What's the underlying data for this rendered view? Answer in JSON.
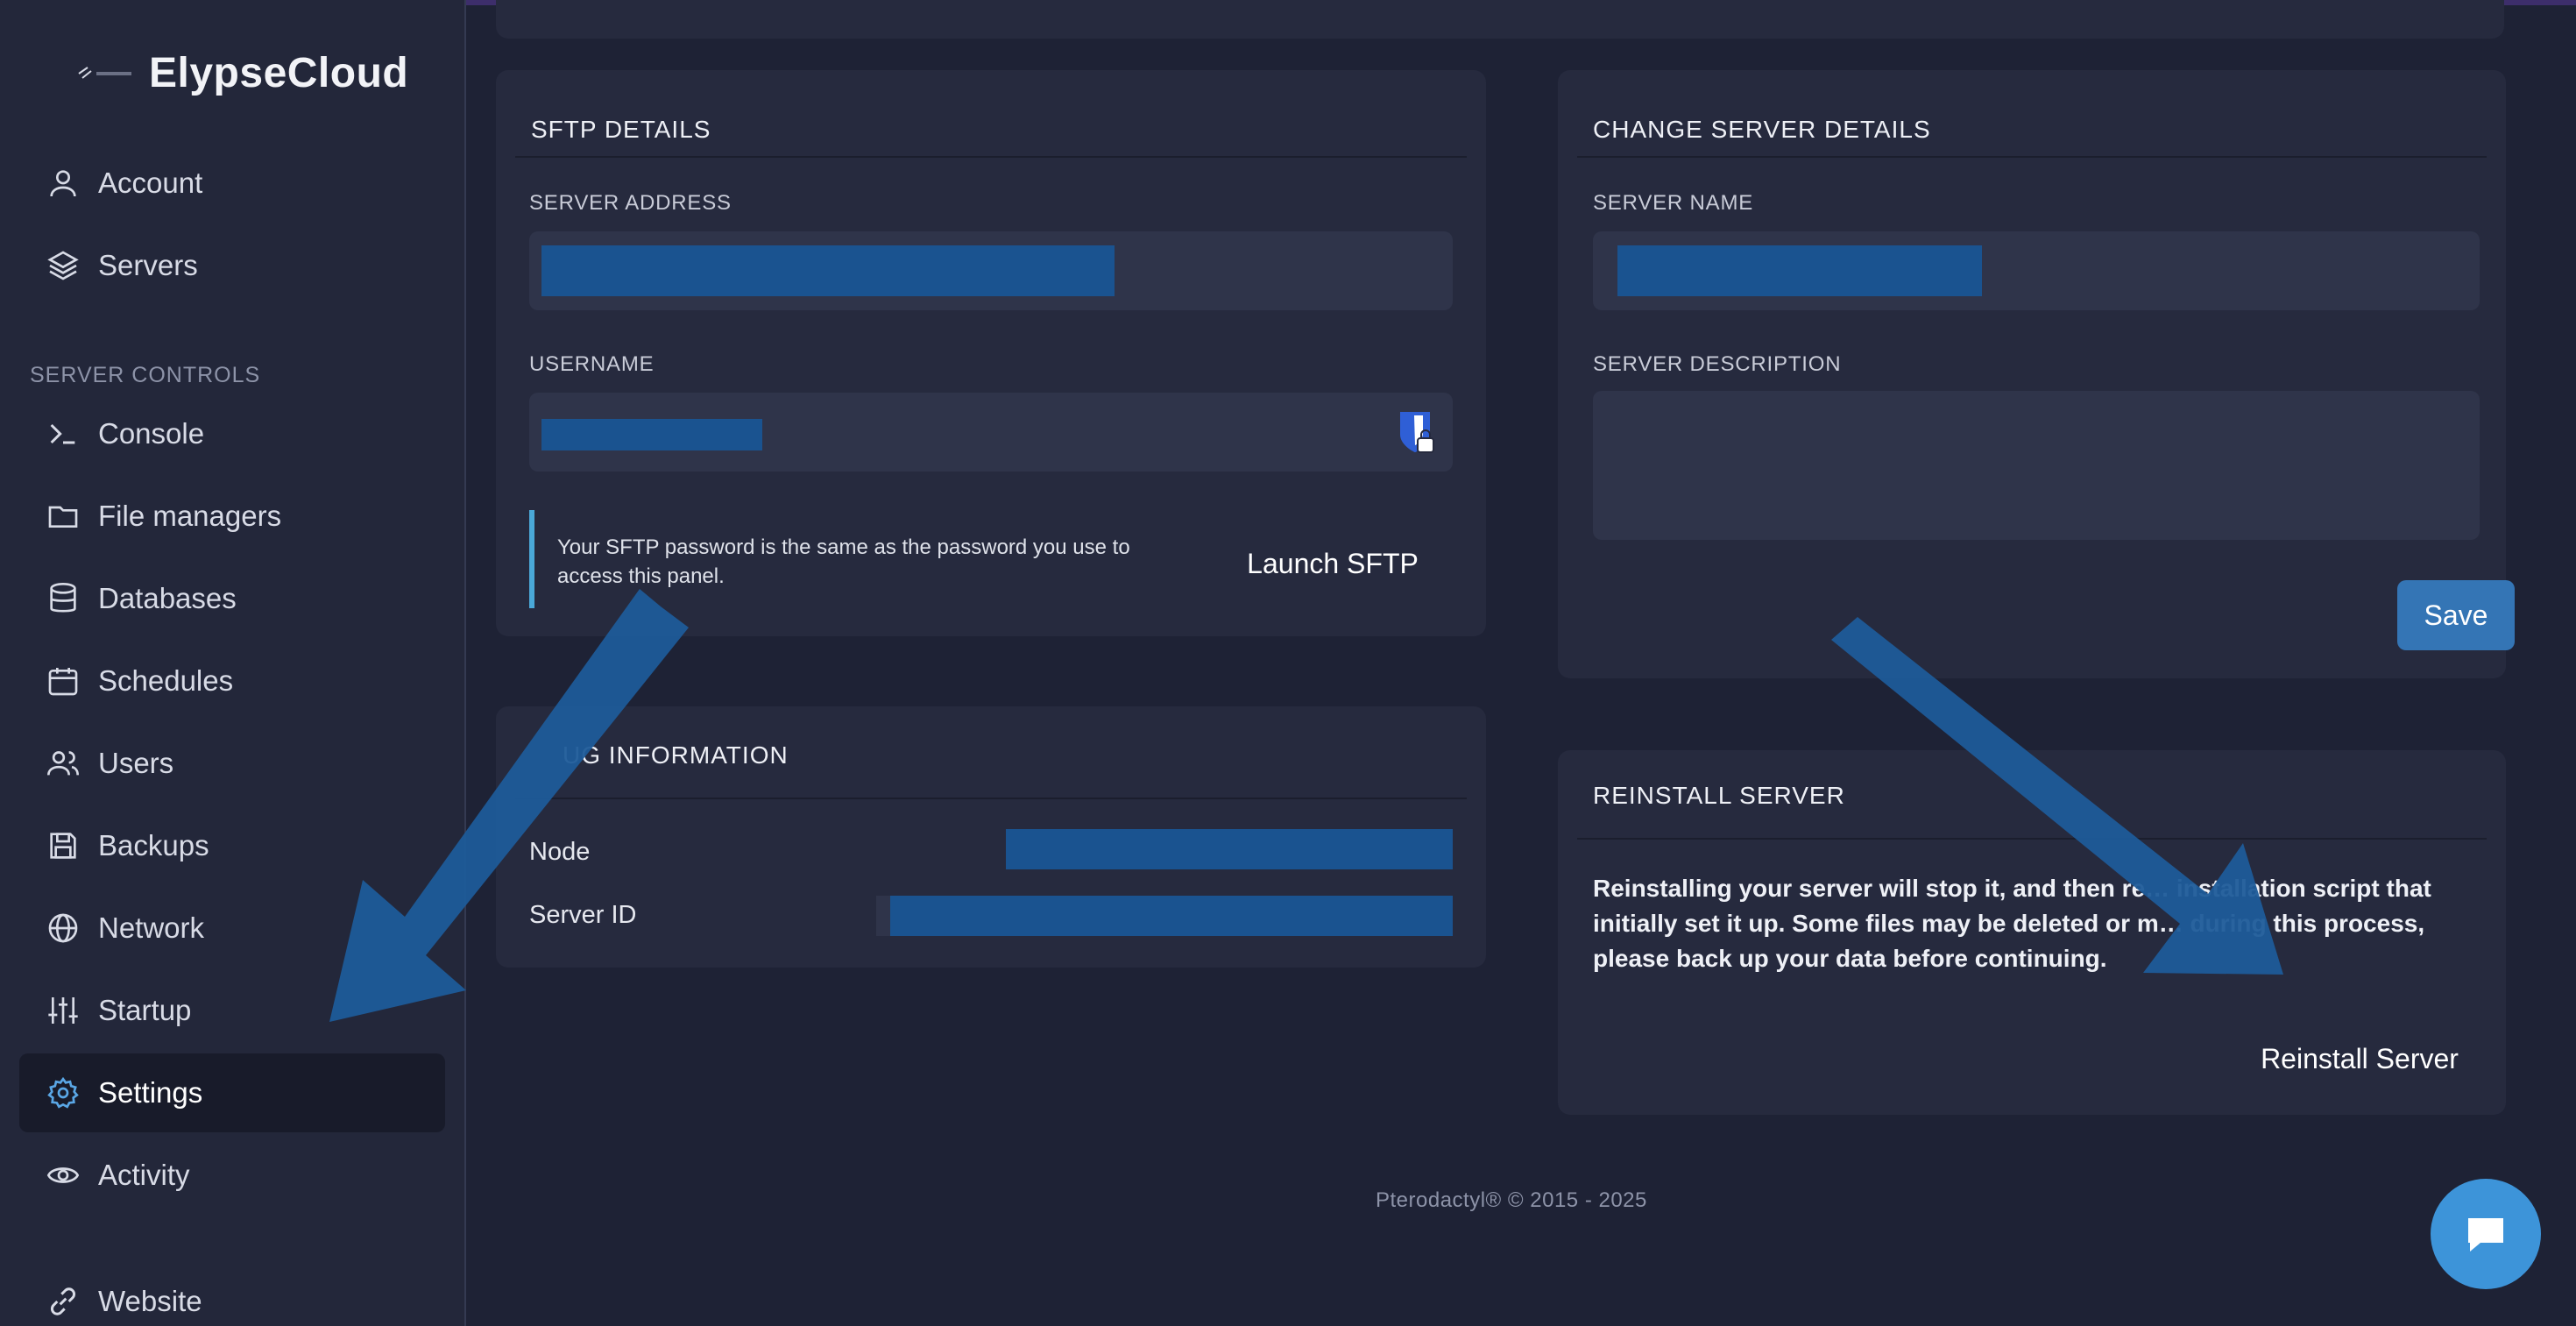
{
  "brand": {
    "name": "ElypseCloud"
  },
  "sidebar": {
    "top_items": [
      {
        "label": "Account",
        "icon": "user-icon"
      },
      {
        "label": "Servers",
        "icon": "layers-icon"
      }
    ],
    "section_label": "SERVER CONTROLS",
    "controls": [
      {
        "label": "Console",
        "icon": "terminal-icon"
      },
      {
        "label": "File managers",
        "icon": "folder-icon"
      },
      {
        "label": "Databases",
        "icon": "database-icon"
      },
      {
        "label": "Schedules",
        "icon": "calendar-icon"
      },
      {
        "label": "Users",
        "icon": "users-icon"
      },
      {
        "label": "Backups",
        "icon": "save-icon"
      },
      {
        "label": "Network",
        "icon": "globe-icon"
      },
      {
        "label": "Startup",
        "icon": "sliders-icon"
      },
      {
        "label": "Settings",
        "icon": "gear-icon",
        "active": true
      },
      {
        "label": "Activity",
        "icon": "eye-icon"
      },
      {
        "label": "Website",
        "icon": "link-icon"
      }
    ]
  },
  "sftp": {
    "title": "SFTP DETAILS",
    "server_address_label": "SERVER ADDRESS",
    "username_label": "USERNAME",
    "note": "Your SFTP password is the same as the password you use to access this panel.",
    "launch_label": "Launch SFTP"
  },
  "debug": {
    "title": "UG INFORMATION",
    "node_label": "Node",
    "server_id_label": "Server ID"
  },
  "change_server": {
    "title": "CHANGE SERVER DETAILS",
    "name_label": "SERVER NAME",
    "description_label": "SERVER DESCRIPTION",
    "save_label": "Save"
  },
  "reinstall": {
    "title": "REINSTALL SERVER",
    "text": "Reinstalling your server will stop it, and then re… installation script that initially set it up. Some files may be deleted or m… during this process, please back up your data before continuing.",
    "button_label": "Reinstall Server"
  },
  "footer": {
    "text": "Pterodactyl® © 2015 - 2025"
  },
  "colors": {
    "background": "#1e2235",
    "sidebar": "#23273a",
    "card": "#262a3e",
    "accent": "#3475b5",
    "redaction": "#1a5390",
    "note_bar": "#4aa8d8"
  }
}
